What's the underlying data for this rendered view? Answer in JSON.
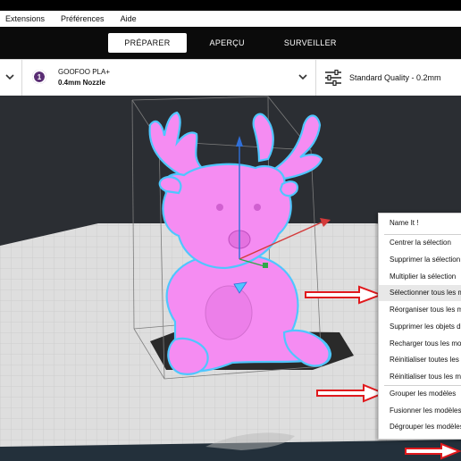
{
  "menubar": {
    "items": [
      {
        "label": "Extensions"
      },
      {
        "label": "Préférences"
      },
      {
        "label": "Aide"
      }
    ]
  },
  "stages": {
    "tabs": [
      {
        "label": "PRÉPARER",
        "active": true
      },
      {
        "label": "APERÇU",
        "active": false
      },
      {
        "label": "SURVEILLER",
        "active": false
      }
    ]
  },
  "config": {
    "extruder_number": "1",
    "material": "GOOFOO PLA+",
    "nozzle": "0.4mm Nozzle",
    "quality": "Standard Quality - 0.2mm",
    "icons": [
      "chevron-down-icon",
      "settings-sliders-icon"
    ]
  },
  "viewport": {
    "model_color": "#f58cf2",
    "outline_color": "#4fc6ff"
  },
  "context_menu": {
    "items": [
      {
        "label": "Name It !"
      },
      {
        "label": "Centrer la sélection"
      },
      {
        "label": "Supprimer la sélection"
      },
      {
        "label": "Multiplier la sélection"
      },
      {
        "label": "Sélectionner tous les modèles"
      },
      {
        "label": "Réorganiser tous les modèles"
      },
      {
        "label": "Supprimer les objets de la plateforme"
      },
      {
        "label": "Recharger tous les modèles"
      },
      {
        "label": "Réinitialiser toutes les positions des modèles"
      },
      {
        "label": "Réinitialiser tous les modèles"
      },
      {
        "label": "Grouper les modèles"
      },
      {
        "label": "Fusionner les modèles"
      },
      {
        "label": "Dégrouper les modèles"
      }
    ]
  },
  "colors": {
    "accent_arrow": "#e0191d",
    "brand_material": "#5a2d74"
  }
}
